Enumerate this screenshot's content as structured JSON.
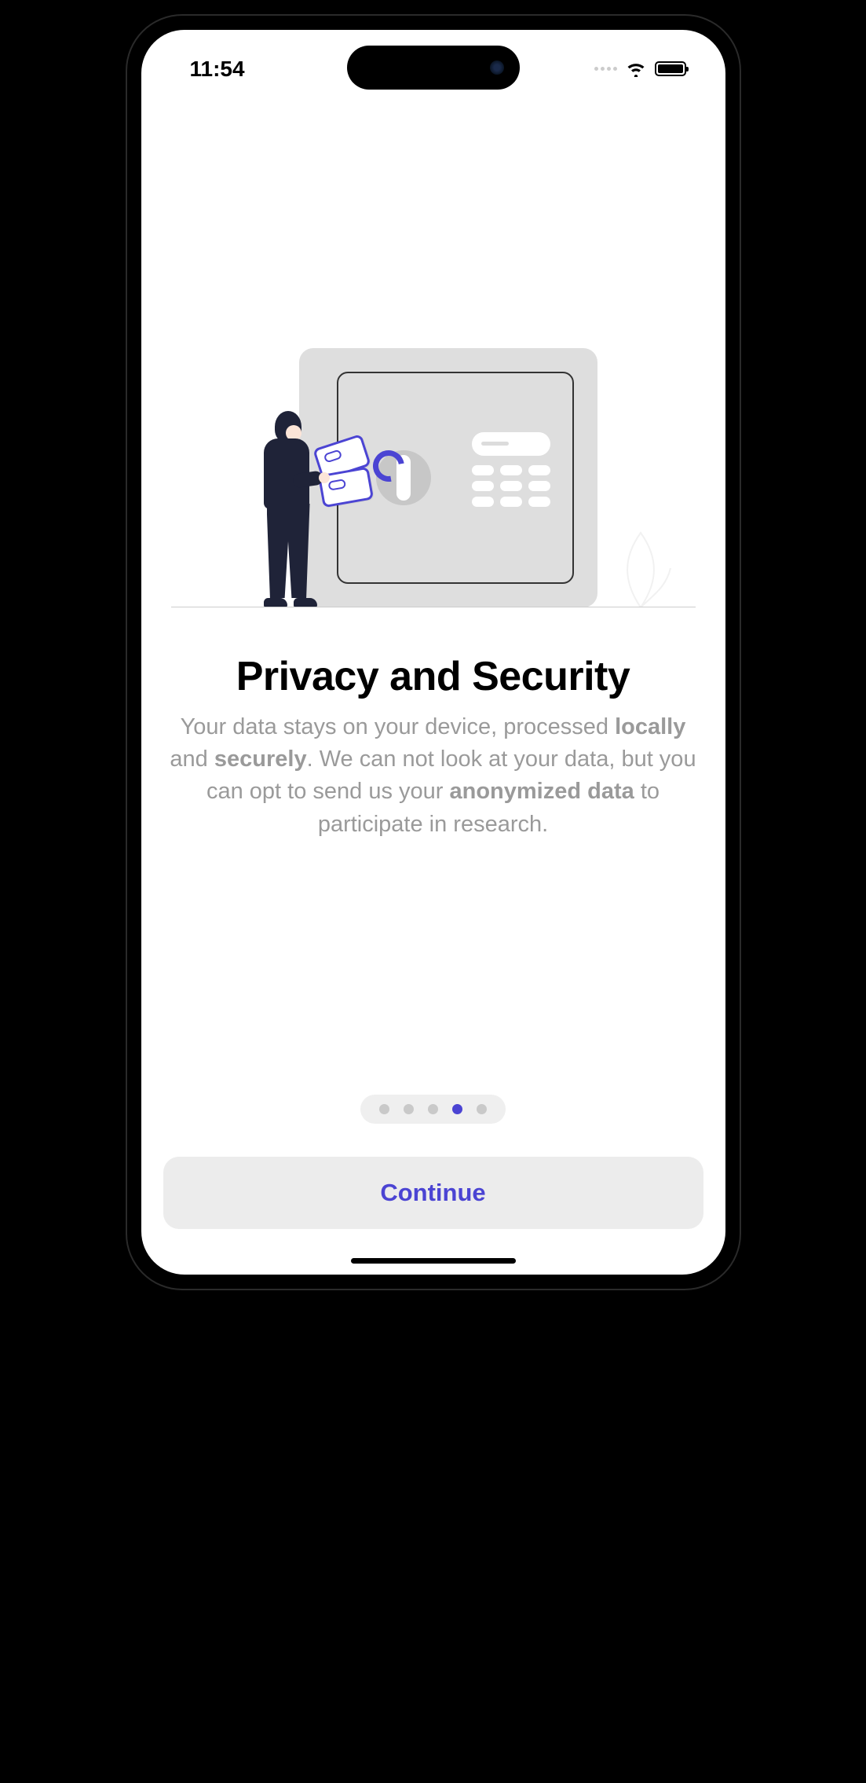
{
  "status_bar": {
    "time": "11:54"
  },
  "onboarding": {
    "heading": "Privacy and Security",
    "body_parts": {
      "p1": "Your data stays on your device, processed ",
      "b1": "locally",
      "p2": " and ",
      "b2": "securely",
      "p3": ". We can not look at your data, but you can opt to send us your ",
      "b3": "anonymized data",
      "p4": " to participate in research."
    },
    "page_indicator": {
      "total": 5,
      "active_index": 3
    },
    "cta_label": "Continue"
  }
}
